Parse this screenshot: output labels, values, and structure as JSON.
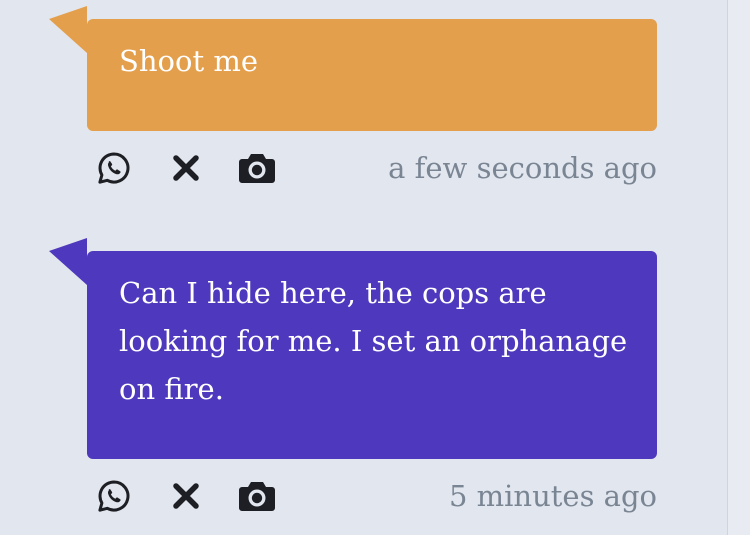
{
  "colors": {
    "background": "#e2e6ee",
    "bubble_orange": "#e39f4c",
    "bubble_purple": "#4e38bd",
    "icon": "#1e1f24",
    "timestamp": "#7a8594"
  },
  "messages": [
    {
      "text": "Shoot me",
      "time": "a few seconds ago",
      "color": "#e39f4c",
      "actions": [
        "whatsapp-icon",
        "close-icon",
        "camera-icon"
      ]
    },
    {
      "text": "Can I hide here, the cops are looking for me. I set an orphanage on fire.",
      "time": "5 minutes ago",
      "color": "#4e38bd",
      "actions": [
        "whatsapp-icon",
        "close-icon",
        "camera-icon"
      ]
    }
  ]
}
